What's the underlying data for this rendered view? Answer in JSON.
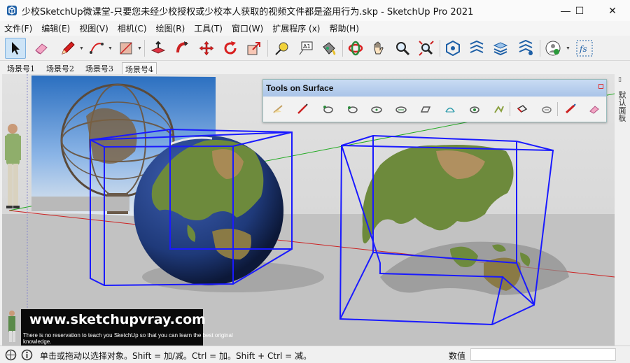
{
  "window": {
    "title": "少校SketchUp微课堂-只要您未经少校授权或少校本人获取的视频文件都是盗用行为.skp - SketchUp Pro 2021",
    "minimize_glyph": "—",
    "maximize_glyph": "☐",
    "close_glyph": "✕"
  },
  "menu": {
    "items": [
      "文件(F)",
      "编辑(E)",
      "视图(V)",
      "相机(C)",
      "绘图(R)",
      "工具(T)",
      "窗口(W)",
      "扩展程序 (x)",
      "帮助(H)"
    ]
  },
  "toolbar": {
    "tools": [
      "select",
      "eraser",
      "pencil",
      "arc",
      "shape",
      "push-pull",
      "follow-me",
      "move",
      "rotate",
      "scale",
      "tape-measure",
      "text",
      "paint-bucket",
      "orbit",
      "pan",
      "zoom",
      "zoom-extents",
      "warehouse",
      "extension-warehouse",
      "layout",
      "send-to-layout",
      "account",
      "fredoscale"
    ],
    "text_tool_glyph": "A1"
  },
  "scenes": {
    "tabs": [
      "场景号1",
      "场景号2",
      "场景号3",
      "场景号4"
    ],
    "active_index": 3
  },
  "tools_on_surface": {
    "title": "Tools on Surface",
    "tool_count": 16
  },
  "watermark": {
    "url": "www.sketchupvray.com",
    "note": "There is no reservation to teach you SketchUp so that you can learn the best original knowledge."
  },
  "right_panel": {
    "label": "默认面板"
  },
  "statusbar": {
    "hint": "单击或拖动以选择对象。Shift = 加/减。Ctrl = 加。Shift + Ctrl = 减。",
    "measurement_label": "数值",
    "measurement_value": ""
  },
  "colors": {
    "selection": "#1a1aff",
    "sky": "#d4d4d4",
    "ground": "#bfbfbf",
    "ocean": "#1f3a7a",
    "land": "#6d8a3c",
    "red_axis": "#cc2222",
    "green_axis": "#22aa22",
    "panel_header": "#b7cdee"
  }
}
